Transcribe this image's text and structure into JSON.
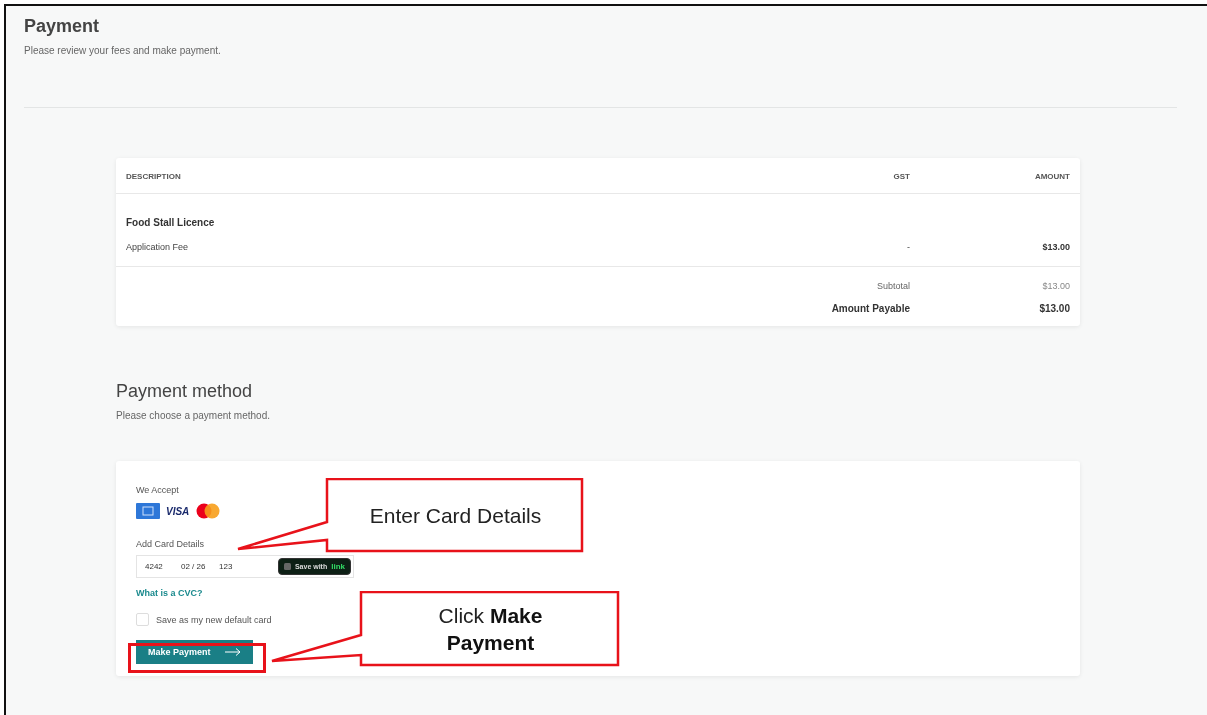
{
  "page": {
    "title": "Payment",
    "subtitle": "Please review your fees and make payment."
  },
  "fees_table": {
    "columns": [
      "DESCRIPTION",
      "GST",
      "AMOUNT"
    ],
    "groups": [
      {
        "title": "Food Stall Licence",
        "items": [
          {
            "description": "Application Fee",
            "gst": "-",
            "amount": "$13.00"
          }
        ]
      }
    ],
    "totals": [
      {
        "label": "Subtotal",
        "value": "$13.00",
        "kind": "subtotal"
      },
      {
        "label": "Amount Payable",
        "value": "$13.00",
        "kind": "total"
      }
    ]
  },
  "payment_method": {
    "title": "Payment method",
    "subtitle": "Please choose a payment method.",
    "accepted_label": "We Accept",
    "brands": [
      {
        "kind": "amex"
      },
      {
        "kind": "visa",
        "text": "VISA"
      },
      {
        "kind": "mastercard"
      }
    ],
    "card_label": "Add Card Details",
    "card_number": "4242",
    "expiry": "02 / 26",
    "cvc": "123",
    "link_button": {
      "text": "Save with",
      "brand": "link"
    },
    "cvc_help_link": "What is a CVC?",
    "save_default": {
      "label": "Save as my new default card",
      "checked": false
    },
    "submit_button": "Make Payment"
  },
  "callouts": [
    {
      "text": "Enter Card Details",
      "kind": "card"
    },
    {
      "text": "Click **Make Payment**",
      "kind": "submit"
    }
  ]
}
